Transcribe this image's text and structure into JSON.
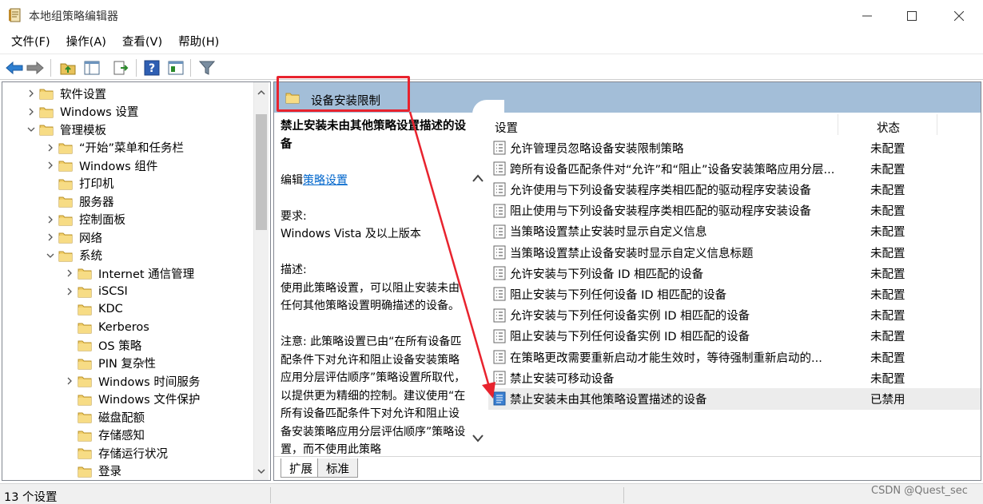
{
  "window": {
    "title": "本地组策略编辑器",
    "minimize_icon": "minimize-icon",
    "maximize_icon": "maximize-icon",
    "close_icon": "close-icon"
  },
  "menu": [
    "文件(F)",
    "操作(A)",
    "查看(V)",
    "帮助(H)"
  ],
  "toolbar": {
    "icons": [
      "back-arrow-icon",
      "forward-arrow-icon",
      "up-folder-icon",
      "show-hide-tree-icon",
      "export-list-icon",
      "help-icon",
      "properties-icon",
      "filter-icon"
    ]
  },
  "tree": {
    "items": [
      {
        "label": "软件设置",
        "level": 1,
        "expander": "collapsed"
      },
      {
        "label": "Windows 设置",
        "level": 1,
        "expander": "collapsed"
      },
      {
        "label": "管理模板",
        "level": 1,
        "expander": "expanded"
      },
      {
        "label": "“开始”菜单和任务栏",
        "level": 2,
        "expander": "collapsed"
      },
      {
        "label": "Windows 组件",
        "level": 2,
        "expander": "collapsed"
      },
      {
        "label": "打印机",
        "level": 2,
        "expander": "none"
      },
      {
        "label": "服务器",
        "level": 2,
        "expander": "none"
      },
      {
        "label": "控制面板",
        "level": 2,
        "expander": "collapsed"
      },
      {
        "label": "网络",
        "level": 2,
        "expander": "collapsed"
      },
      {
        "label": "系统",
        "level": 2,
        "expander": "expanded"
      },
      {
        "label": "Internet 通信管理",
        "level": 3,
        "expander": "collapsed"
      },
      {
        "label": "iSCSI",
        "level": 3,
        "expander": "collapsed"
      },
      {
        "label": "KDC",
        "level": 3,
        "expander": "none"
      },
      {
        "label": "Kerberos",
        "level": 3,
        "expander": "none"
      },
      {
        "label": "OS 策略",
        "level": 3,
        "expander": "none"
      },
      {
        "label": "PIN 复杂性",
        "level": 3,
        "expander": "none"
      },
      {
        "label": "Windows 时间服务",
        "level": 3,
        "expander": "collapsed"
      },
      {
        "label": "Windows 文件保护",
        "level": 3,
        "expander": "none"
      },
      {
        "label": "磁盘配额",
        "level": 3,
        "expander": "none"
      },
      {
        "label": "存储感知",
        "level": 3,
        "expander": "none"
      },
      {
        "label": "存储运行状况",
        "level": 3,
        "expander": "none"
      },
      {
        "label": "登录",
        "level": 3,
        "expander": "none"
      }
    ]
  },
  "right_pane": {
    "header_title": "设备安装限制",
    "description": {
      "title": "禁止安装未由其他策略设置描述的设备",
      "edit_prefix": "编辑",
      "edit_link": "策略设置",
      "requirements_label": "要求:",
      "requirements_value": "Windows Vista 及以上版本",
      "description_label": "描述:",
      "description_text": "使用此策略设置，可以阻止安装未由任何其他策略设置明确描述的设备。",
      "note_text": "注意: 此策略设置已由“在所有设备匹配条件下对允许和阻止设备安装策略应用分层评估顺序”策略设置所取代，以提供更为精细的控制。建议使用“在所有设备匹配条件下对允许和阻止设备安装策略应用分层评估顺序”策略设置，而不使用此策略"
    },
    "columns": {
      "setting": "设置",
      "state": "状态"
    },
    "rows": [
      {
        "name": "允许管理员忽略设备安装限制策略",
        "state": "未配置",
        "selected": false
      },
      {
        "name": "跨所有设备匹配条件对“允许”和“阻止”设备安装策略应用分层...",
        "state": "未配置",
        "selected": false
      },
      {
        "name": "允许使用与下列设备安装程序类相匹配的驱动程序安装设备",
        "state": "未配置",
        "selected": false
      },
      {
        "name": "阻止使用与下列设备安装程序类相匹配的驱动程序安装设备",
        "state": "未配置",
        "selected": false
      },
      {
        "name": "当策略设置禁止安装时显示自定义信息",
        "state": "未配置",
        "selected": false
      },
      {
        "name": "当策略设置禁止设备安装时显示自定义信息标题",
        "state": "未配置",
        "selected": false
      },
      {
        "name": "允许安装与下列设备 ID 相匹配的设备",
        "state": "未配置",
        "selected": false
      },
      {
        "name": "阻止安装与下列任何设备 ID 相匹配的设备",
        "state": "未配置",
        "selected": false
      },
      {
        "name": "允许安装与下列任何设备实例 ID 相匹配的设备",
        "state": "未配置",
        "selected": false
      },
      {
        "name": "阻止安装与下列任何设备实例 ID 相匹配的设备",
        "state": "未配置",
        "selected": false
      },
      {
        "name": "在策略更改需要重新启动才能生效时，等待强制重新启动的...",
        "state": "未配置",
        "selected": false
      },
      {
        "name": "禁止安装可移动设备",
        "state": "未配置",
        "selected": false
      },
      {
        "name": "禁止安装未由其他策略设置描述的设备",
        "state": "已禁用",
        "selected": true
      }
    ],
    "tabs": [
      "扩展",
      "标准"
    ]
  },
  "statusbar": {
    "text": "13 个设置"
  },
  "watermark": "CSDN @Quest_sec",
  "colors": {
    "header_band": "#a3bed8",
    "annotation_red": "#e8232e",
    "link": "#0066cc",
    "selected_row": "#ececec"
  }
}
